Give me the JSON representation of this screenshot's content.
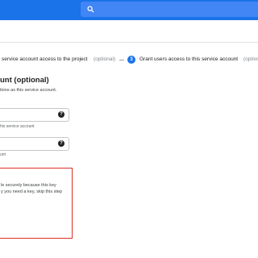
{
  "header": {
    "search_icon": "search-icon"
  },
  "stepper": {
    "step2_text": "service account access to the project",
    "step2_optional": "(optional)",
    "separator": "—",
    "step3_number": "3",
    "step3_text": "Grant users access to this service account",
    "step3_optional": "(optional"
  },
  "section": {
    "title": "unt (optional)",
    "description": "tions as this service account."
  },
  "fields": [
    {
      "help_icon": "help-icon",
      "hint": "his service account"
    },
    {
      "help_icon": "help-icon",
      "hint": "unt"
    }
  ],
  "warning": {
    "lines": [
      "le securely because this key",
      "y you need a key, skip this step"
    ]
  },
  "colors": {
    "header": "#1a73e8",
    "accent": "#1a73e8",
    "warning_border": "#d93025"
  }
}
